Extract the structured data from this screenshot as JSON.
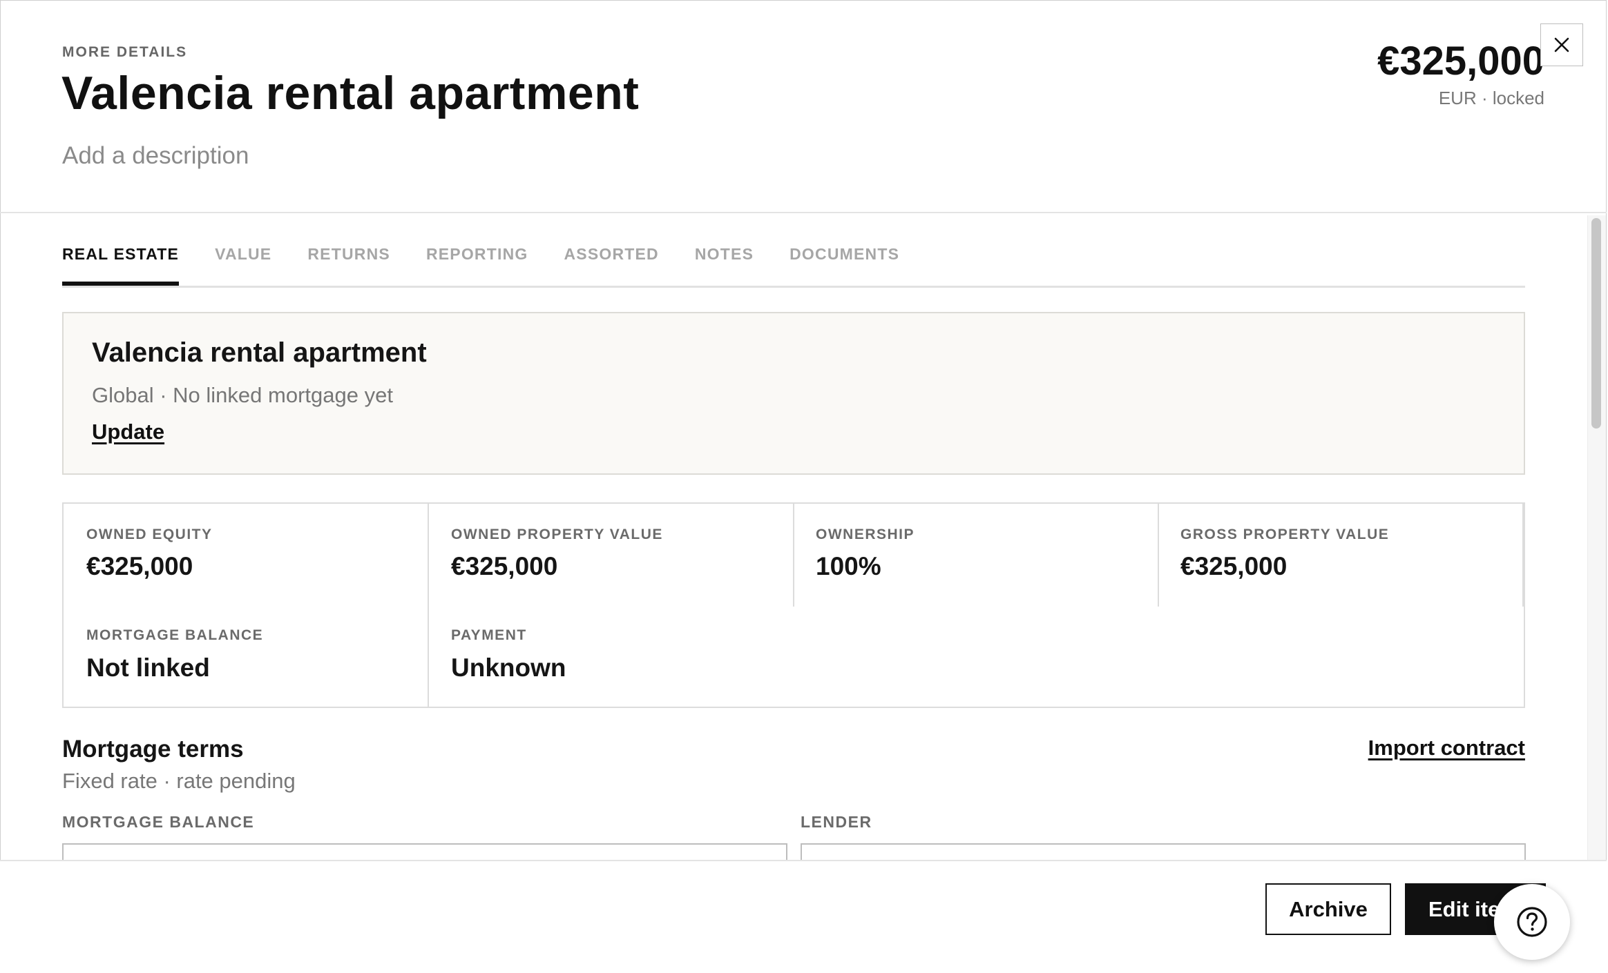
{
  "header": {
    "eyebrow": "MORE DETAILS",
    "title": "Valencia rental apartment",
    "description_placeholder": "Add a description",
    "amount": "€325,000",
    "amount_meta": "EUR · locked",
    "close_icon": "close-icon"
  },
  "tabs": [
    {
      "label": "REAL ESTATE",
      "active": true
    },
    {
      "label": "VALUE"
    },
    {
      "label": "RETURNS"
    },
    {
      "label": "REPORTING"
    },
    {
      "label": "ASSORTED"
    },
    {
      "label": "NOTES"
    },
    {
      "label": "DOCUMENTS"
    }
  ],
  "summary": {
    "title": "Valencia rental apartment",
    "subtitle": "Global · No linked mortgage yet",
    "link": "Update"
  },
  "metrics": {
    "owned_equity": {
      "label": "OWNED EQUITY",
      "value": "€325,000"
    },
    "owned_property_value": {
      "label": "OWNED PROPERTY VALUE",
      "value": "€325,000"
    },
    "ownership": {
      "label": "OWNERSHIP",
      "value": "100%"
    },
    "gross_property_value": {
      "label": "GROSS PROPERTY VALUE",
      "value": "€325,000"
    },
    "mortgage_balance": {
      "label": "MORTGAGE BALANCE",
      "value": "Not linked"
    },
    "payment": {
      "label": "PAYMENT",
      "value": "Unknown"
    }
  },
  "mortgage_terms": {
    "title": "Mortgage terms",
    "subtitle": "Fixed rate · rate pending",
    "import_link": "Import contract",
    "fields": {
      "balance_label": "MORTGAGE BALANCE",
      "lender_label": "LENDER"
    }
  },
  "footer": {
    "archive_label": "Archive",
    "edit_label": "Edit item",
    "help_icon": "help-icon"
  },
  "colors": {
    "text": "#151515",
    "muted": "#767676",
    "card_bg": "#faf9f6",
    "primary_button": "#111111"
  }
}
